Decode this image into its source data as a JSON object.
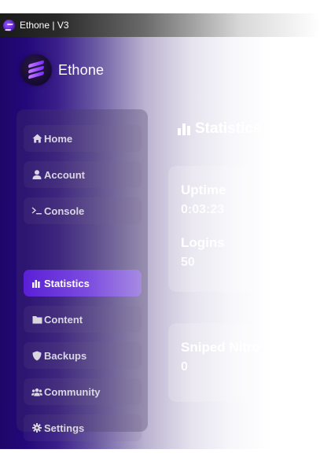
{
  "window": {
    "title": "Ethone | V3"
  },
  "brand": {
    "name": "Ethone"
  },
  "sidebar": {
    "items": [
      {
        "label": "Home",
        "icon": "home-icon"
      },
      {
        "label": "Account",
        "icon": "user-icon"
      },
      {
        "label": "Console",
        "icon": "terminal-icon"
      },
      {
        "label": "Statistics",
        "icon": "bar-chart-icon",
        "active": true
      },
      {
        "label": "Content",
        "icon": "folder-icon"
      },
      {
        "label": "Backups",
        "icon": "shield-icon"
      },
      {
        "label": "Community",
        "icon": "users-icon"
      },
      {
        "label": "Settings",
        "icon": "gear-icon"
      }
    ]
  },
  "main": {
    "title": "Statistics",
    "stats": {
      "uptime": {
        "label": "Uptime",
        "value": "0:03:23"
      },
      "logins": {
        "label": "Logins",
        "value": "50"
      },
      "sniped_nitro": {
        "label": "Sniped Nitro",
        "value": "0"
      }
    }
  },
  "colors": {
    "accent": "#5a1fd6",
    "background_dark": "#1d0668",
    "text": "#ffffff"
  }
}
